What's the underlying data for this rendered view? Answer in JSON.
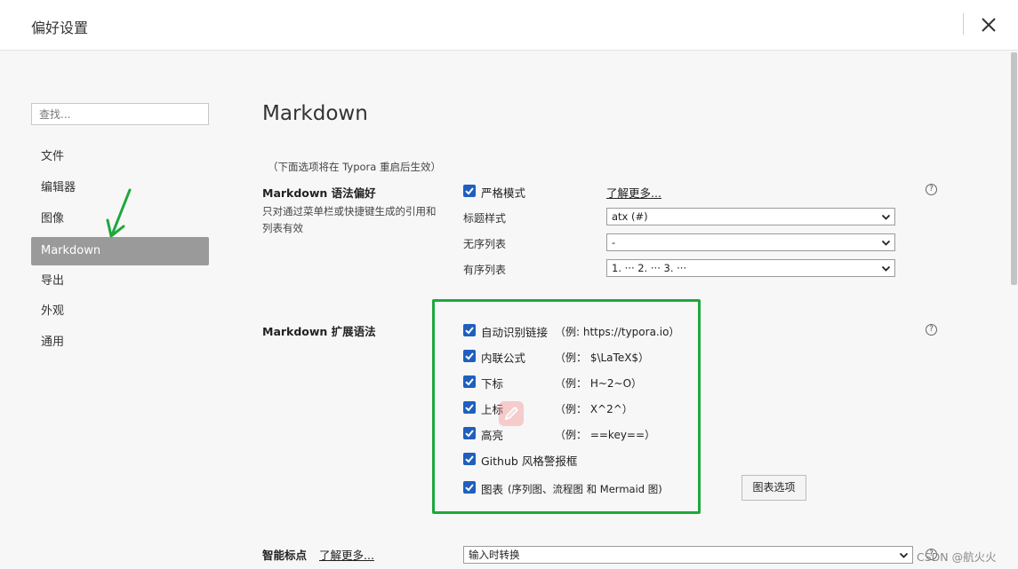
{
  "window": {
    "title": "偏好设置"
  },
  "sidebar": {
    "search_placeholder": "查找...",
    "items": [
      {
        "label": "文件",
        "active": false
      },
      {
        "label": "编辑器",
        "active": false
      },
      {
        "label": "图像",
        "active": false
      },
      {
        "label": "Markdown",
        "active": true
      },
      {
        "label": "导出",
        "active": false
      },
      {
        "label": "外观",
        "active": false
      },
      {
        "label": "通用",
        "active": false
      }
    ]
  },
  "main": {
    "title": "Markdown",
    "restart_note": "（下面选项将在 Typora 重启后生效）",
    "syntax_pref": {
      "title": "Markdown 语法偏好",
      "description": "只对通过菜单栏或快捷键生成的引用和列表有效",
      "strict_mode": {
        "label": "严格模式",
        "checked": true
      },
      "learn_more": "了解更多...",
      "heading_style": {
        "label": "标题样式",
        "value": "atx (#)"
      },
      "unordered_list": {
        "label": "无序列表",
        "value": "-"
      },
      "ordered_list": {
        "label": "有序列表",
        "value": "1. ··· 2. ··· 3. ···"
      }
    },
    "extended_syntax": {
      "title": "Markdown 扩展语法",
      "options": [
        {
          "label": "自动识别链接",
          "example": "（例: https://typora.io）",
          "checked": true
        },
        {
          "label": "内联公式",
          "example": "（例： $\\LaTeX$）",
          "checked": true
        },
        {
          "label": "下标",
          "example": "（例： H~2~O）",
          "checked": true
        },
        {
          "label": "上标",
          "example": "（例： X^2^）",
          "checked": true
        },
        {
          "label": "高亮",
          "example": "（例： ==key==）",
          "checked": true
        },
        {
          "label": "Github 风格警报框",
          "example": "",
          "checked": true
        },
        {
          "label": "图表",
          "example": "(序列图、流程图 和 Mermaid 图)",
          "checked": true
        }
      ],
      "chart_options_button": "图表选项"
    },
    "smart_punct": {
      "title": "智能标点",
      "learn_more": "了解更多...",
      "value": "输入时转换"
    }
  },
  "watermark": "CSDN @航火火",
  "colors": {
    "accent": "#1f5fbf",
    "highlight_box": "#1ea83c",
    "active_nav": "#9a9a9a"
  }
}
